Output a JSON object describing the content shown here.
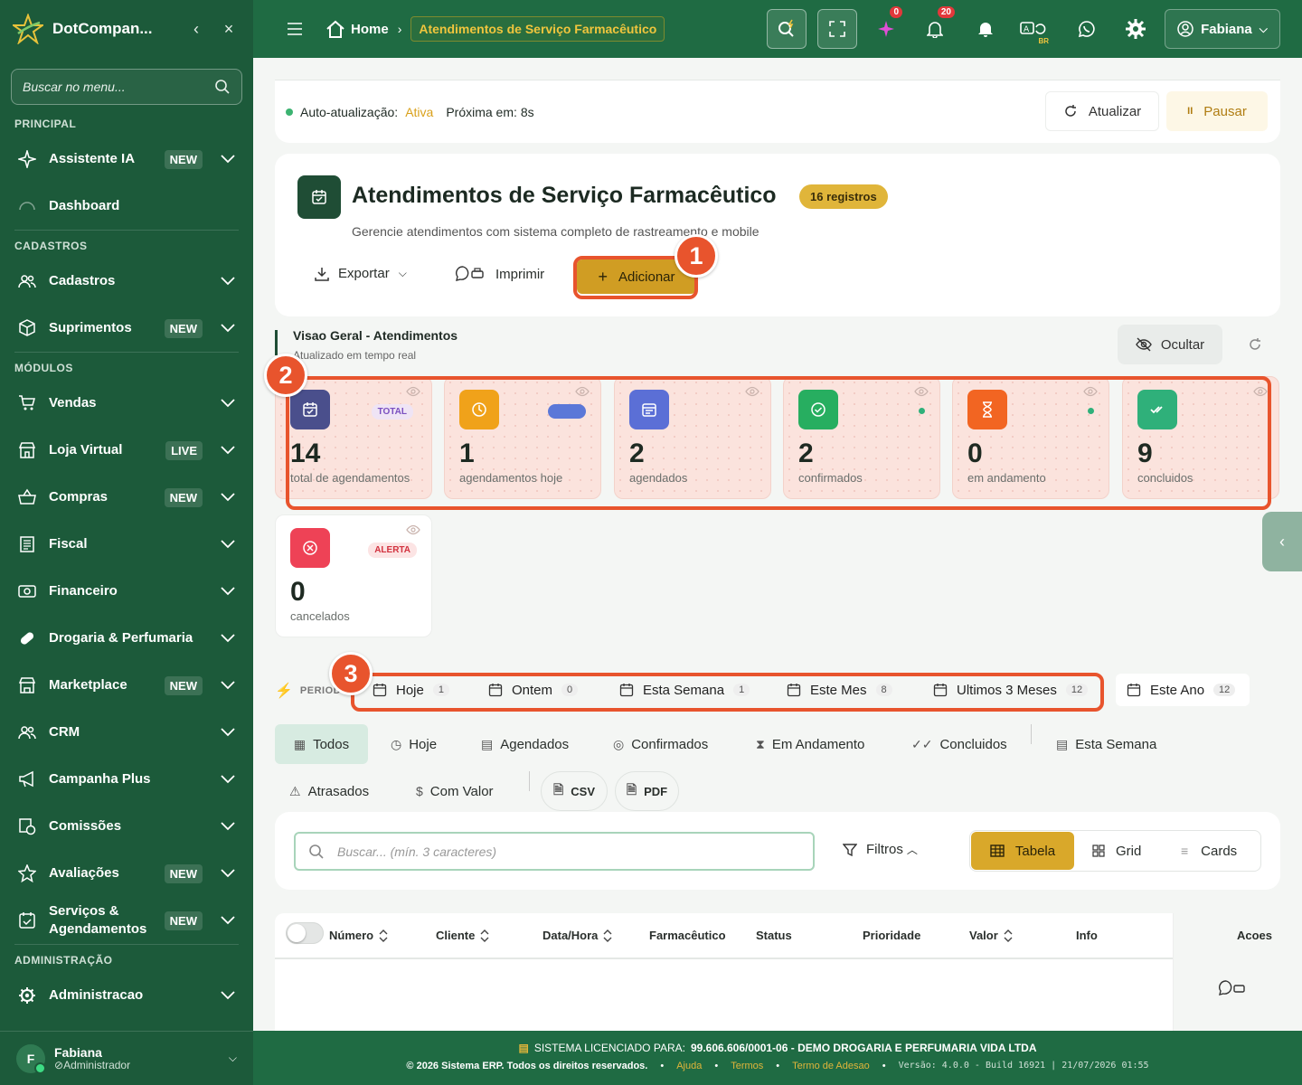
{
  "app": {
    "name": "DotCompan..."
  },
  "sidebar": {
    "search_placeholder": "Buscar no menu...",
    "sections": {
      "principal": "PRINCIPAL",
      "cadastros": "CADASTROS",
      "modulos": "MÓDULOS",
      "administracao": "ADMINISTRAÇÃO"
    },
    "items": [
      {
        "label": "Assistente IA",
        "badge": "NEW",
        "icon": "sparkle-icon"
      },
      {
        "label": "Dashboard",
        "badge": "",
        "icon": "gauge-icon"
      },
      {
        "label": "Cadastros",
        "badge": "",
        "icon": "users-icon"
      },
      {
        "label": "Suprimentos",
        "badge": "NEW",
        "icon": "box-icon"
      },
      {
        "label": "Vendas",
        "badge": "",
        "icon": "cart-icon"
      },
      {
        "label": "Loja Virtual",
        "badge": "LIVE",
        "icon": "store-icon"
      },
      {
        "label": "Compras",
        "badge": "NEW",
        "icon": "basket-icon"
      },
      {
        "label": "Fiscal",
        "badge": "",
        "icon": "receipt-icon"
      },
      {
        "label": "Financeiro",
        "badge": "",
        "icon": "money-icon"
      },
      {
        "label": "Drogaria & Perfumaria",
        "badge": "",
        "icon": "pill-icon"
      },
      {
        "label": "Marketplace",
        "badge": "NEW",
        "icon": "shop-icon"
      },
      {
        "label": "CRM",
        "badge": "",
        "icon": "users-icon"
      },
      {
        "label": "Campanha Plus",
        "badge": "",
        "icon": "megaphone-icon"
      },
      {
        "label": "Comissões",
        "badge": "",
        "icon": "commission-icon"
      },
      {
        "label": "Avaliações",
        "badge": "NEW",
        "icon": "star-icon"
      },
      {
        "label": "Serviços & Agendamentos",
        "badge": "NEW",
        "icon": "calendar-check-icon"
      },
      {
        "label": "Administracao",
        "badge": "",
        "icon": "gear-icon"
      }
    ],
    "user": {
      "initial": "F",
      "name": "Fabiana",
      "role": "Administrador"
    }
  },
  "topbar": {
    "home": "Home",
    "current": "Atendimentos de Serviço Farmacêutico",
    "ai_count": "0",
    "notif_count": "20",
    "lang": "BR",
    "user": "Fabiana"
  },
  "auto": {
    "label": "Auto-atualização:",
    "status": "Ativa",
    "next_label": "Próxima em:",
    "next_value": "8s",
    "refresh": "Atualizar",
    "pause": "Pausar"
  },
  "header": {
    "title": "Atendimentos de Serviço Farmacêutico",
    "count": "16 registros",
    "subtitle": "Gerencie atendimentos com sistema completo de rastreamento e mobile",
    "export": "Exportar",
    "print": "Imprimir",
    "add": "Adicionar"
  },
  "overview": {
    "title": "Visao Geral - Atendimentos",
    "subtitle": "Atualizado em tempo real",
    "hide": "Ocultar"
  },
  "stats": [
    {
      "value": "14",
      "label": "total de agendamentos",
      "tag": "TOTAL",
      "color": "#4a4f8c"
    },
    {
      "value": "1",
      "label": "agendamentos hoje",
      "tag": "",
      "color": "#f0a21a"
    },
    {
      "value": "2",
      "label": "agendados",
      "tag": "",
      "color": "#5b6fd6"
    },
    {
      "value": "2",
      "label": "confirmados",
      "tag": "",
      "color": "#27ae60"
    },
    {
      "value": "0",
      "label": "em andamento",
      "tag": "",
      "color": "#f26522"
    },
    {
      "value": "9",
      "label": "concluidos",
      "tag": "",
      "color": "#2fb07a"
    },
    {
      "value": "0",
      "label": "cancelados",
      "tag": "ALERTA",
      "color": "#ee4256"
    }
  ],
  "periods": {
    "label": "PERIOD",
    "items": [
      {
        "label": "Hoje",
        "count": "1"
      },
      {
        "label": "Ontem",
        "count": "0"
      },
      {
        "label": "Esta Semana",
        "count": "1"
      },
      {
        "label": "Este Mes",
        "count": "8"
      },
      {
        "label": "Ultimos 3 Meses",
        "count": "12"
      },
      {
        "label": "Este Ano",
        "count": "12"
      }
    ]
  },
  "filters": [
    "Todos",
    "Hoje",
    "Agendados",
    "Confirmados",
    "Em Andamento",
    "Concluidos",
    "Esta Semana",
    "Atrasados",
    "Com Valor",
    "CSV",
    "PDF"
  ],
  "search": {
    "placeholder": "Buscar... (mín. 3 caracteres)",
    "filters": "Filtros",
    "views": [
      "Tabela",
      "Grid",
      "Cards"
    ]
  },
  "table": {
    "columns": [
      "Número",
      "Cliente",
      "Data/Hora",
      "Farmacêutico",
      "Status",
      "Prioridade",
      "Valor",
      "Info",
      "Acoes"
    ]
  },
  "annotations": [
    "1",
    "2",
    "3"
  ],
  "footer": {
    "licensed_label": "SISTEMA LICENCIADO PARA:",
    "licensed_value": "99.606.606/0001-06 - DEMO DROGARIA E PERFUMARIA VIDA LTDA",
    "copyright": "© 2026 Sistema ERP. Todos os direitos reservados.",
    "help": "Ajuda",
    "terms": "Termos",
    "adhesion": "Termo de Adesao",
    "version": "Versão: 4.0.0 - Build 16921 | 21/07/2026 01:55"
  }
}
